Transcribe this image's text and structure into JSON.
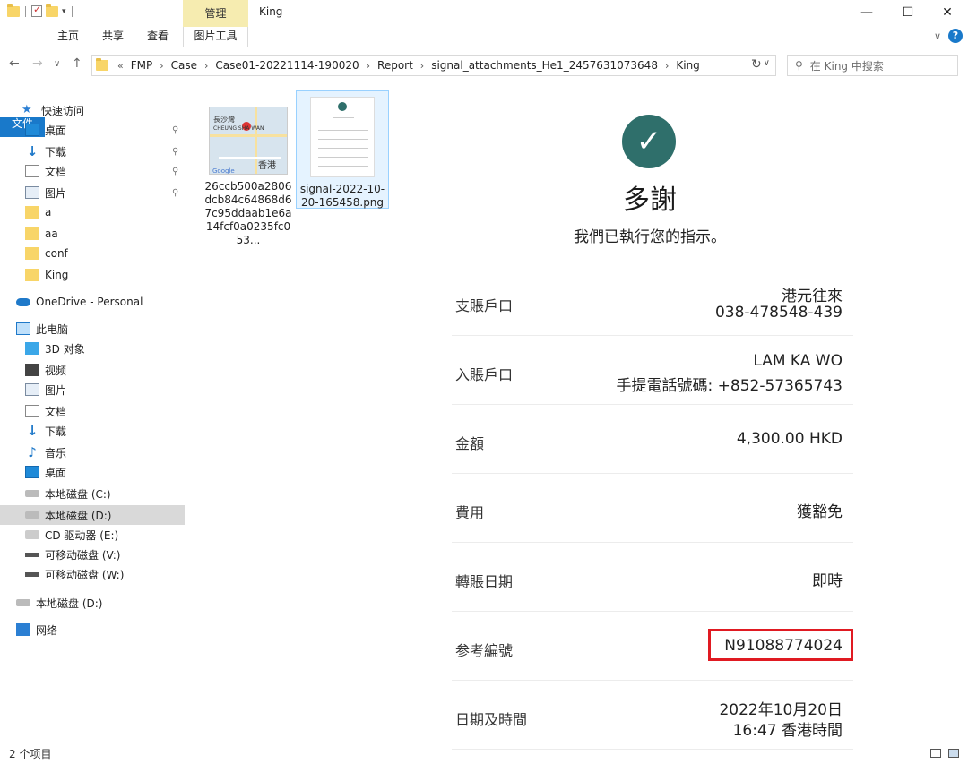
{
  "window": {
    "title": "King",
    "manage_tab": "管理",
    "minimize": "—",
    "maximize": "☐",
    "close": "✕"
  },
  "ribbon": {
    "tabs": [
      "文件",
      "主页",
      "共享",
      "查看"
    ],
    "picture_tools": "图片工具",
    "expand": "∨",
    "help": "?"
  },
  "address": {
    "prefix": "«",
    "crumbs": [
      "FMP",
      "Case",
      "Case01-20221114-190020",
      "Report",
      "signal_attachments_He1_2457631073648",
      "King"
    ],
    "search_placeholder": "在 King 中搜索"
  },
  "sidebar": {
    "items": [
      {
        "label": "快速访问",
        "icon": "star-icon"
      },
      {
        "label": "桌面",
        "icon": "desktop-icon",
        "pinned": true
      },
      {
        "label": "下载",
        "icon": "download-icon",
        "pinned": true
      },
      {
        "label": "文档",
        "icon": "document-icon",
        "pinned": true
      },
      {
        "label": "图片",
        "icon": "picture-icon",
        "pinned": true
      },
      {
        "label": "a",
        "icon": "folder-icon"
      },
      {
        "label": "aa",
        "icon": "folder-icon"
      },
      {
        "label": "conf",
        "icon": "folder-icon"
      },
      {
        "label": "King",
        "icon": "folder-icon"
      },
      {
        "label": "OneDrive - Personal",
        "icon": "cloud-icon"
      },
      {
        "label": "此电脑",
        "icon": "computer-icon"
      },
      {
        "label": "3D 对象",
        "icon": "cube-icon"
      },
      {
        "label": "视频",
        "icon": "video-icon"
      },
      {
        "label": "图片",
        "icon": "picture-icon"
      },
      {
        "label": "文档",
        "icon": "document-icon"
      },
      {
        "label": "下载",
        "icon": "download-icon"
      },
      {
        "label": "音乐",
        "icon": "music-icon"
      },
      {
        "label": "桌面",
        "icon": "desktop-icon"
      },
      {
        "label": "本地磁盘 (C:)",
        "icon": "drive-icon"
      },
      {
        "label": "本地磁盘 (D:)",
        "icon": "drive-icon",
        "selected": true
      },
      {
        "label": "CD 驱动器 (E:)",
        "icon": "cd-drive-icon"
      },
      {
        "label": "可移动磁盘 (V:)",
        "icon": "usb-drive-icon"
      },
      {
        "label": "可移动磁盘 (W:)",
        "icon": "usb-drive-icon"
      },
      {
        "label": "本地磁盘 (D:)",
        "icon": "drive-icon"
      },
      {
        "label": "网络",
        "icon": "network-icon"
      }
    ]
  },
  "files": [
    {
      "name": "26ccb500a2806dcb84c64868d67c95ddaab1e6a14fcf0a0235fc053...",
      "map_labels": [
        "長沙灣",
        "CHEUNG SHA WAN",
        "香港",
        "Google"
      ]
    },
    {
      "name": "signal-2022-10-20-165458.png",
      "selected": true
    }
  ],
  "preview": {
    "check": "✓",
    "title": "多謝",
    "subtitle": "我們已執行您的指示。",
    "rows": [
      {
        "label": "支賬戶口",
        "value1": "港元往來",
        "value2": "038-478548-439"
      },
      {
        "label": "入賬戶口",
        "value1": "LAM KA WO",
        "value2": "手提電話號碼: +852-57365743"
      },
      {
        "label": "金額",
        "value1": "4,300.00 HKD"
      },
      {
        "label": "費用",
        "value1": "獲豁免"
      },
      {
        "label": "轉賬日期",
        "value1": "即時"
      },
      {
        "label": "参考編號",
        "value1": "N91088774024",
        "highlight": true
      },
      {
        "label": "日期及時間",
        "value1": "2022年10月20日",
        "value2": "16:47 香港時間"
      }
    ],
    "highlight_color": "#e01a22",
    "accent_color": "#2f6f6b"
  },
  "status": {
    "count": "2 个项目"
  }
}
